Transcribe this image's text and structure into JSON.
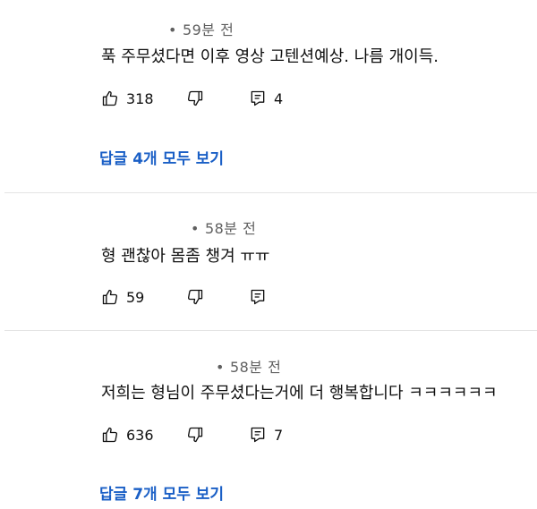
{
  "comments": [
    {
      "time": "59분 전",
      "text": "푹 주무셨다면 이후 영상 고텐션예상. 나름 개이득.",
      "likes": "318",
      "replies_count": "4",
      "view_replies": "답글 4개 모두 보기"
    },
    {
      "time": "58분 전",
      "text": "형 괜찮아 몸좀 챙겨 ㅠㅠ",
      "likes": "59",
      "replies_count": "",
      "view_replies": ""
    },
    {
      "time": "58분 전",
      "text": "저희는 형님이 주무셨다는거에 더 행복합니다 ㅋㅋㅋㅋㅋㅋ",
      "likes": "636",
      "replies_count": "7",
      "view_replies": "답글 7개 모두 보기"
    }
  ],
  "meta_separator": "•",
  "icons": [
    "thumbs-up-icon",
    "thumbs-down-icon",
    "reply-icon"
  ]
}
